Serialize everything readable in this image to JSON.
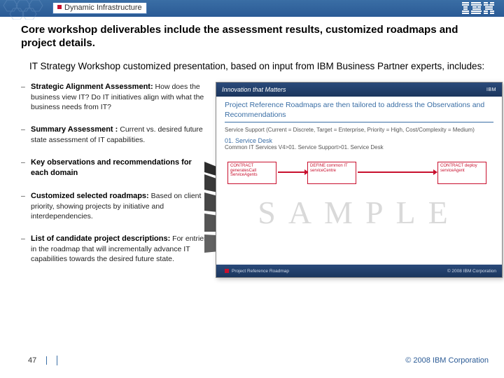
{
  "header": {
    "brand_tag": "Dynamic Infrastructure",
    "logo_alt": "IBM"
  },
  "title": "Core workshop deliverables include the assessment results, customized roadmaps and project details.",
  "subtitle": "IT Strategy Workshop customized presentation, based on input from IBM Business Partner experts, includes:",
  "bullets": [
    {
      "lead": "Strategic Alignment Assessment:",
      "rest": " How does the business view IT? Do IT initiatives align with what the business needs from IT?"
    },
    {
      "lead": "Summary Assessment :",
      "rest": " Current vs. desired future state assessment of IT capabilities."
    },
    {
      "lead": "Key observations and recommendations for each domain",
      "rest": ""
    },
    {
      "lead": "Customized selected roadmaps:",
      "rest": " Based on client priority, showing projects by initiative and interdependencies."
    },
    {
      "lead": "List of candidate project descriptions:",
      "rest": " For entries in the roadmap that will incrementally advance IT capabilities towards the desired future state."
    }
  ],
  "sample": {
    "header_tag": "Innovation that Matters",
    "header_logo": "IBM",
    "title_line1": "Project Reference Roadmaps are then tailored to address the Observations and",
    "title_line2": "Recommendations",
    "meta": "Service Support (Current = Discrete, Target = Enterprise, Priority = High, Cost/Complexity = Medium)",
    "sub1": "01. Service Desk",
    "sub2": "Common IT Services V4>01. Service Support>01. Service Desk",
    "box1": "CONTRACT generatesCall ServiceAgents",
    "box2": "DEFINE common IT serviceCentre",
    "box3": "CONTRACT deploy serviceAgent",
    "watermark": "SAMPLE",
    "footer_left": "Project Reference Roadmap",
    "footer_right": "© 2008 IBM Corporation"
  },
  "footer": {
    "page": "47",
    "copyright": "© 2008 IBM Corporation"
  }
}
